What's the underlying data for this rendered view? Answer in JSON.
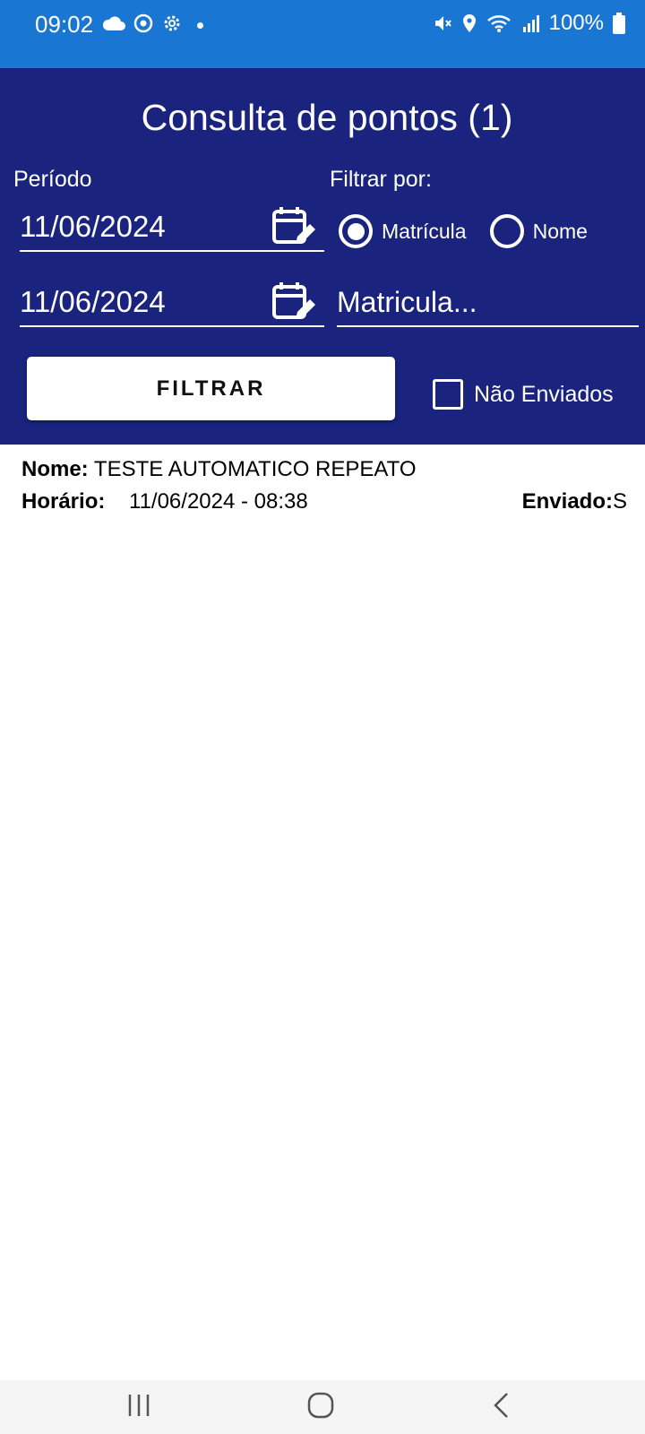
{
  "status": {
    "time": "09:02",
    "battery": "100%",
    "icons_left": [
      "cloud-icon",
      "sync-icon",
      "settings-icon",
      "dot-icon"
    ],
    "icons_right": [
      "mute-icon",
      "location-icon",
      "wifi-icon",
      "signal-icon",
      "battery-icon"
    ]
  },
  "header": {
    "title": "Consulta de pontos (1)",
    "period_label": "Período",
    "filter_label": "Filtrar por:",
    "date_start": "11/06/2024",
    "date_end": "11/06/2024",
    "radio_options": [
      {
        "label": "Matrícula",
        "selected": true
      },
      {
        "label": "Nome",
        "selected": false
      }
    ],
    "search_placeholder": "Matricula...",
    "filter_button": "FILTRAR",
    "checkbox_label": "Não Enviados",
    "checkbox_checked": false
  },
  "results": [
    {
      "name_label": "Nome:",
      "name_value": "TESTE AUTOMATICO REPEATO",
      "time_label": "Horário:",
      "time_value": "11/06/2024 - 08:38",
      "sent_label": "Enviado:",
      "sent_value": "S"
    }
  ],
  "colors": {
    "status_bar": "#1976D2",
    "header": "#1A237E",
    "text_on_header": "#FFFFFF"
  }
}
